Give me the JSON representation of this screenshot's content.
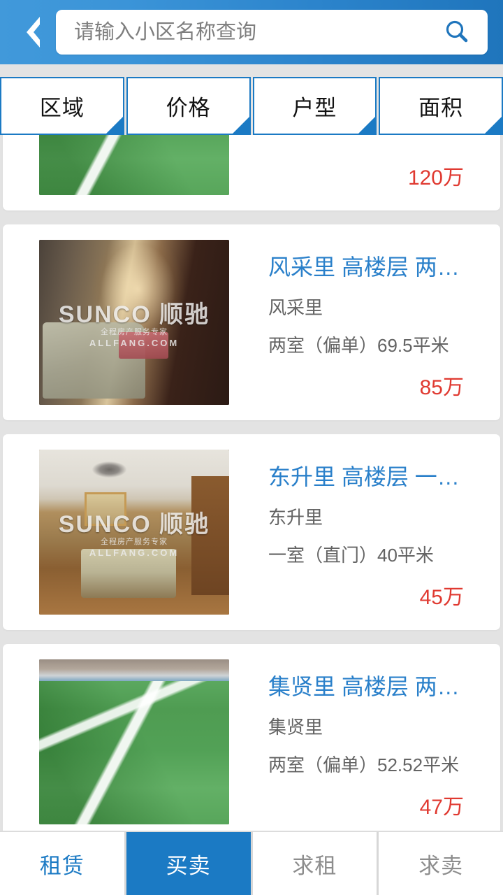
{
  "header": {
    "back_icon": "chevron-left-icon",
    "search": {
      "value": "",
      "placeholder": "请输入小区名称查询",
      "icon": "search-icon"
    },
    "bg_start": "#4199da",
    "bg_end": "#1f75bc"
  },
  "filters": [
    {
      "label": "区域"
    },
    {
      "label": "价格"
    },
    {
      "label": "户型"
    },
    {
      "label": "面积"
    }
  ],
  "listings": [
    {
      "title": "",
      "community": "",
      "spec": "",
      "price": "120万",
      "photo": "field",
      "clipped": true
    },
    {
      "title": "风采里 高楼层 两…",
      "community": "风采里",
      "spec": "两室（偏单）69.5平米",
      "price": "85万",
      "photo": "room1",
      "clipped": false
    },
    {
      "title": "东升里 高楼层 一…",
      "community": "东升里",
      "spec": "一室（直门）40平米",
      "price": "45万",
      "photo": "room2",
      "clipped": false
    },
    {
      "title": "集贤里 高楼层 两…",
      "community": "集贤里",
      "spec": "两室（偏单）52.52平米",
      "price": "47万",
      "photo": "field",
      "clipped": false
    }
  ],
  "watermark": {
    "line1": "SUNCO 顺驰",
    "line2": "全程房产服务专家",
    "line3": "ALLFANG.COM"
  },
  "bottom_tabs": [
    {
      "label": "租赁",
      "state": "blue"
    },
    {
      "label": "买卖",
      "state": "active"
    },
    {
      "label": "求租",
      "state": "normal"
    },
    {
      "label": "求卖",
      "state": "normal"
    }
  ],
  "colors": {
    "accent": "#1b7ac4",
    "title": "#2a80ca",
    "price": "#e03a31",
    "page_bg": "#e3e3e3"
  }
}
